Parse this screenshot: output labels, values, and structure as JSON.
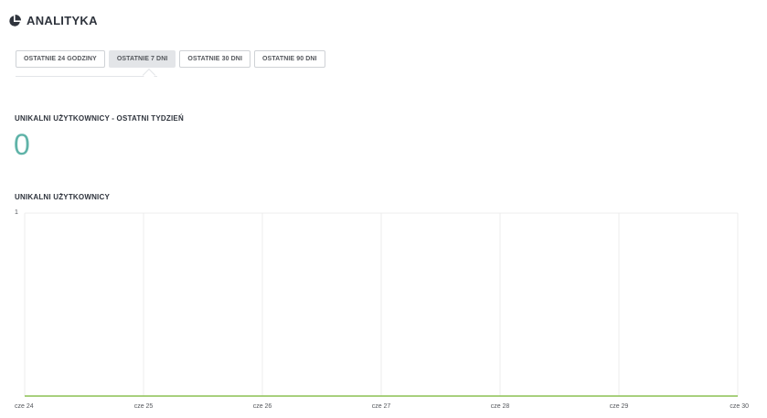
{
  "header": {
    "title": "ANALITYKA",
    "icon": "pie-chart-icon"
  },
  "tabs": [
    {
      "label": "OSTATNIE 24 GODZINY",
      "active": false
    },
    {
      "label": "OSTATNIE 7 DNI",
      "active": true
    },
    {
      "label": "OSTATNIE 30 DNI",
      "active": false
    },
    {
      "label": "OSTATNIE 90 DNI",
      "active": false
    }
  ],
  "summary": {
    "label": "UNIKALNI UŻYTKOWNICY - OSTATNI TYDZIEŃ",
    "value": "0",
    "value_color": "#5fb3a8"
  },
  "chart_section": {
    "label": "UNIKALNI UŻYTKOWNICY"
  },
  "chart_data": {
    "type": "line",
    "x": [
      "cze 24",
      "cze 25",
      "cze 26",
      "cze 27",
      "cze 28",
      "cze 29",
      "cze 30"
    ],
    "series": [
      {
        "values": [
          0,
          0,
          0,
          0,
          0,
          0,
          0
        ],
        "color": "#8cc152"
      }
    ],
    "ylim": [
      0,
      1
    ],
    "yticks": [
      "1"
    ],
    "grid": true
  }
}
